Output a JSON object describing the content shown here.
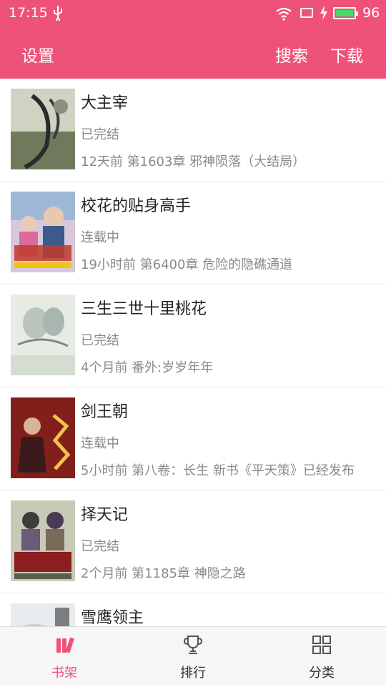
{
  "status_bar": {
    "time": "17:15",
    "battery_level": "96"
  },
  "app_bar": {
    "settings_label": "设置",
    "search_label": "搜索",
    "download_label": "下载"
  },
  "books": [
    {
      "title": "大主宰",
      "status": "已完结",
      "update": "12天前 第1603章 邪神陨落（大结局）"
    },
    {
      "title": "校花的贴身高手",
      "status": "连载中",
      "update": "19小时前 第6400章 危险的隐礁通道"
    },
    {
      "title": "三生三世十里桃花",
      "status": "已完结",
      "update": "4个月前 番外:岁岁年年"
    },
    {
      "title": "剑王朝",
      "status": "连载中",
      "update": "5小时前 第八卷：长生 新书《平天策》已经发布"
    },
    {
      "title": "择天记",
      "status": "已完结",
      "update": "2个月前 第1185章 神隐之路"
    },
    {
      "title": "雪鹰领主",
      "status": "",
      "update": ""
    }
  ],
  "bottom_nav": [
    {
      "label": "书架",
      "icon": "bookshelf-icon",
      "active": true
    },
    {
      "label": "排行",
      "icon": "trophy-icon",
      "active": false
    },
    {
      "label": "分类",
      "icon": "grid-icon",
      "active": false
    }
  ],
  "colors": {
    "accent": "#ef5278",
    "battery_fill": "#4cd964"
  }
}
